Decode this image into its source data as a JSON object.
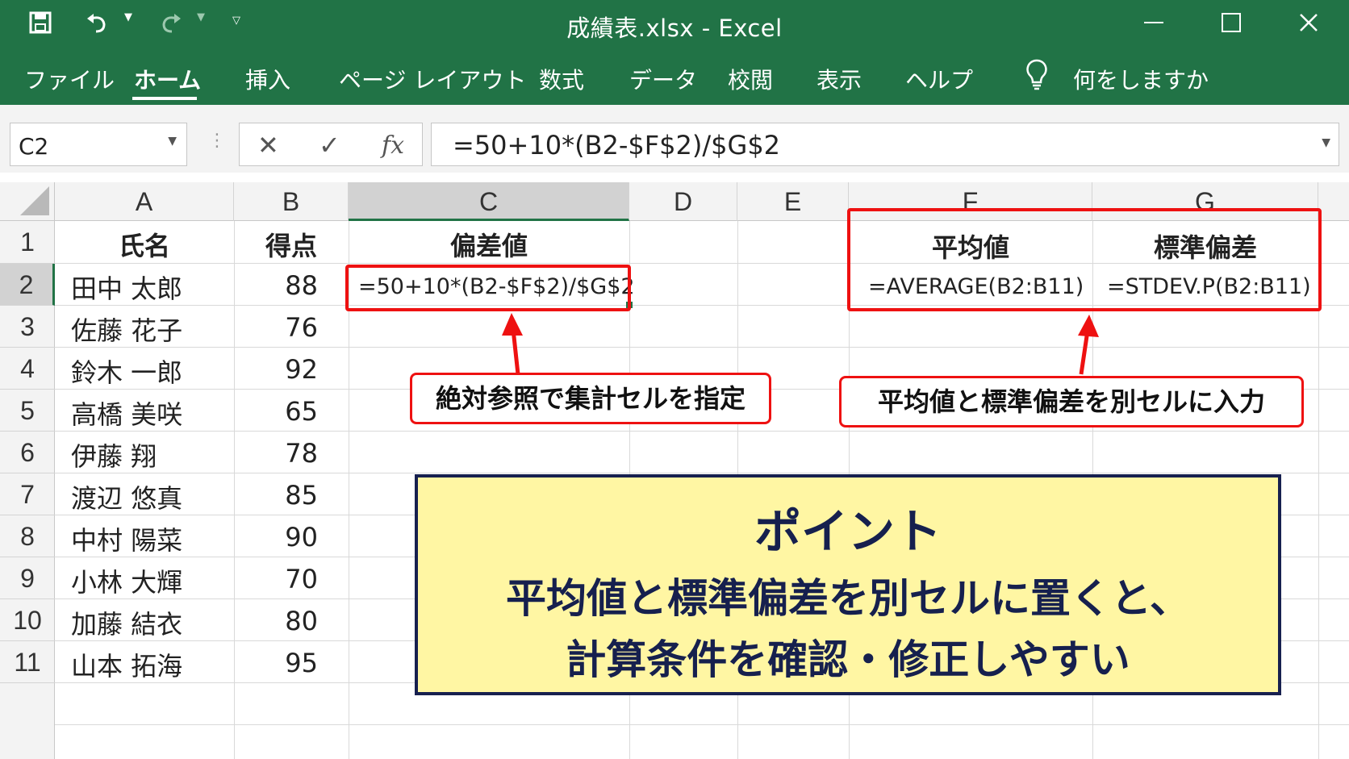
{
  "window": {
    "title": "成績表.xlsx  -  Excel"
  },
  "ribbon": {
    "tabs": [
      "ファイル",
      "ホーム",
      "挿入",
      "ページ レイアウト",
      "数式",
      "データ",
      "校閲",
      "表示",
      "ヘルプ"
    ],
    "tell_me": "何をしますか"
  },
  "formula_bar": {
    "name_box": "C2",
    "formula": "=50+10*(B2-$F$2)/$G$2"
  },
  "columns": [
    "A",
    "B",
    "C",
    "D",
    "E",
    "F",
    "G"
  ],
  "rows": [
    "1",
    "2",
    "3",
    "4",
    "5",
    "6",
    "7",
    "8",
    "9",
    "10",
    "11"
  ],
  "headers": {
    "name": "氏名",
    "score": "得点",
    "deviation": "偏差値",
    "mean": "平均値",
    "stdev": "標準偏差"
  },
  "students": [
    {
      "name": "田中 太郎",
      "score": "88"
    },
    {
      "name": "佐藤 花子",
      "score": "76"
    },
    {
      "name": "鈴木 一郎",
      "score": "92"
    },
    {
      "name": "高橋 美咲",
      "score": "65"
    },
    {
      "name": "伊藤 翔",
      "score": "78"
    },
    {
      "name": "渡辺 悠真",
      "score": "85"
    },
    {
      "name": "中村 陽菜",
      "score": "90"
    },
    {
      "name": "小林 大輝",
      "score": "70"
    },
    {
      "name": "加藤 結衣",
      "score": "80"
    },
    {
      "name": "山本 拓海",
      "score": "95"
    }
  ],
  "cells": {
    "c2": "=50+10*(B2-$F$2)/$G$2",
    "f2": "=AVERAGE(B2:B11)",
    "g2": "=STDEV.P(B2:B11)"
  },
  "callouts": {
    "left": "絶対参照で集計セルを指定",
    "right": "平均値と標準偏差を別セルに入力"
  },
  "point": {
    "title": "ポイント",
    "line1": "平均値と標準偏差を別セルに置くと、",
    "line2": "計算条件を確認・修正しやすい"
  },
  "colors": {
    "excel_green": "#217346",
    "callout_red": "#ee1111",
    "point_bg": "#fff6a3",
    "point_text": "#16204e"
  }
}
